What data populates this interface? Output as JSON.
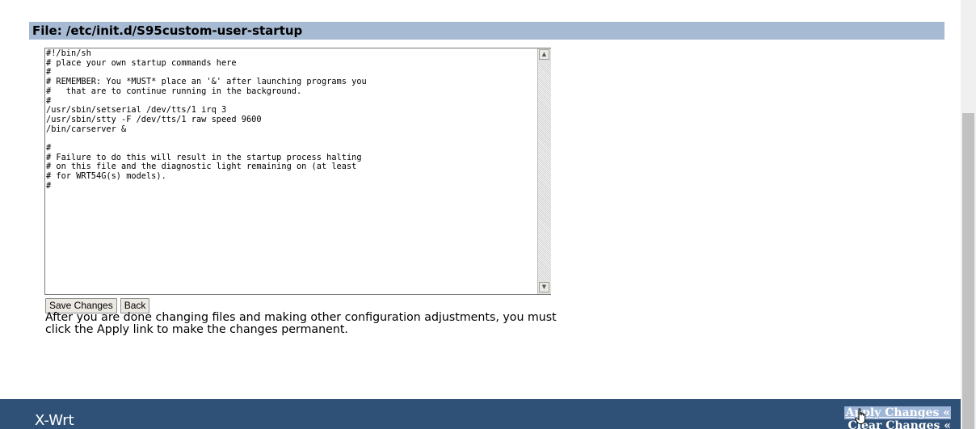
{
  "file_header": {
    "title": "File: /etc/init.d/S95custom-user-startup"
  },
  "editor": {
    "content": "#!/bin/sh\n# place your own startup commands here\n#\n# REMEMBER: You *MUST* place an '&' after launching programs you\n#   that are to continue running in the background.\n#\n/usr/sbin/setserial /dev/tts/1 irq 3\n/usr/sbin/stty -F /dev/tts/1 raw speed 9600\n/bin/carserver &\n\n#\n# Failure to do this will result in the startup process halting\n# on this file and the diagnostic light remaining on (at least\n# for WRT54G(s) models).\n#"
  },
  "buttons": {
    "save_label": "Save Changes",
    "back_label": "Back"
  },
  "info": {
    "text": "After you are done changing files and making other configuration adjustments, you must click the Apply link to make the changes permanent."
  },
  "footer": {
    "brand": "X-Wrt",
    "apply_label": "Apply Changes «",
    "clear_label": "Clear Changes «"
  },
  "colors": {
    "header_bg": "#a7bad3",
    "footer_bg": "#2f5177",
    "link_highlight": "#9db5d6"
  },
  "icons": {
    "scroll_up": "arrow-up-icon",
    "scroll_down": "arrow-down-icon",
    "cursor": "hand-pointer-icon"
  }
}
